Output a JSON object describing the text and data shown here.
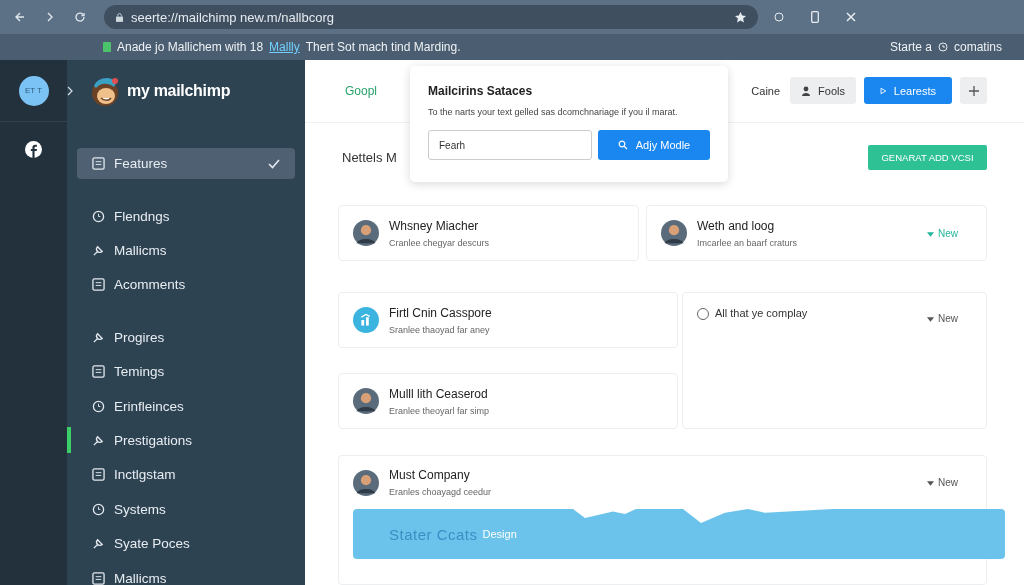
{
  "browser": {
    "url": "seerte://mailchimp new.m/nallbcorg",
    "bookmark_text": "Anade jo Mallichem with 18",
    "bookmark_link": "Mallly",
    "bookmark_tail": "Thert Sot mach tind Marding.",
    "right_link": "Starte a",
    "right_menu": "comatins"
  },
  "rail": {
    "avatar": "ET T"
  },
  "brand": {
    "name": "my mailchimp"
  },
  "sidebar": {
    "sections": [
      {
        "items": [
          {
            "label": "Features",
            "selected": true,
            "marker": false
          }
        ]
      },
      {
        "items": [
          {
            "label": "Flendngs",
            "selected": false,
            "marker": false
          },
          {
            "label": "Mallicms",
            "selected": false,
            "marker": false
          },
          {
            "label": "Acomments",
            "selected": false,
            "marker": false
          }
        ]
      },
      {
        "items": [
          {
            "label": "Progires",
            "selected": false,
            "marker": false
          },
          {
            "label": "Temings",
            "selected": false,
            "marker": false
          },
          {
            "label": "Erinfleinces",
            "selected": false,
            "marker": false
          },
          {
            "label": "Prestigations",
            "selected": false,
            "marker": true
          },
          {
            "label": "Inctlgstam",
            "selected": false,
            "marker": false
          },
          {
            "label": "Systems",
            "selected": false,
            "marker": false
          },
          {
            "label": "Syate Poces",
            "selected": false,
            "marker": false
          },
          {
            "label": "Mallicms",
            "selected": false,
            "marker": false
          }
        ]
      }
    ]
  },
  "header": {
    "tab": "Goopl",
    "caption": "Caine",
    "buttons": [
      {
        "label": "Fools",
        "kind": "secondary"
      },
      {
        "label": "Learests",
        "kind": "primary"
      }
    ]
  },
  "popup": {
    "title": "Mailcirins Sataces",
    "text": "To the narts your text gelled sas dcomchnariage if you il marat.",
    "field": {
      "value": "Fearh"
    },
    "button": "Adjy Modle"
  },
  "toolbar": {
    "title": "Nettels M",
    "action": "GENARAT ADD VCSI"
  },
  "cards": [
    {
      "title": "Whsney Miacher",
      "subtitle": "Cranlee chegyar descurs",
      "kind": "person"
    },
    {
      "title": "Weth and loog",
      "subtitle": "Imcarlee an baarf craturs",
      "kind": "person",
      "badge": {
        "label": "New",
        "accent": true
      }
    },
    {
      "title": "Firtl Cnin Casspore",
      "subtitle": "Sranlee thaoyad far aney",
      "kind": "chart"
    },
    {
      "title": "All that ye complay",
      "kind": "option",
      "checked": false,
      "badge": {
        "label": "New",
        "accent": false
      }
    },
    {
      "title": "Mulll lith Ceaserod",
      "subtitle": "Eranlee theoyarl far simp",
      "kind": "person"
    },
    {
      "title": "Must Company",
      "subtitle": "Eranles choayagd ceedur",
      "kind": "person",
      "badge": {
        "label": "New",
        "accent": false
      },
      "banner": {
        "title": "Stater Ccats",
        "tag": "Design"
      }
    }
  ]
}
